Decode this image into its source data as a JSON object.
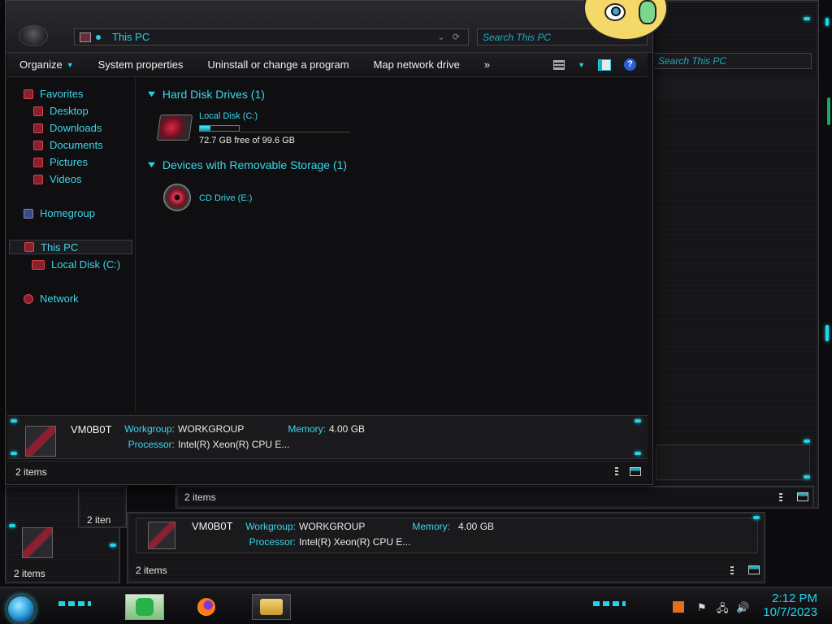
{
  "window": {
    "address": "This PC",
    "search_placeholder": "Search This PC"
  },
  "toolbar": {
    "organize": "Organize",
    "system_properties": "System properties",
    "uninstall": "Uninstall or change a program",
    "map_drive": "Map network drive",
    "more": "»"
  },
  "nav": {
    "favorites": "Favorites",
    "desktop": "Desktop",
    "downloads": "Downloads",
    "documents": "Documents",
    "pictures": "Pictures",
    "videos": "Videos",
    "homegroup": "Homegroup",
    "this_pc": "This PC",
    "local_disk": "Local Disk (C:)",
    "network": "Network"
  },
  "content": {
    "hdd_group": "Hard Disk Drives (1)",
    "removable_group": "Devices with Removable Storage (1)",
    "local_disk_name": "Local Disk (C:)",
    "local_disk_free": "72.7 GB free of 99.6 GB",
    "local_disk_used_fraction": 0.27,
    "cd_drive_name": "CD Drive (E:)"
  },
  "details": {
    "computer_name": "VM0B0T",
    "workgroup_label": "Workgroup:",
    "workgroup_value": "WORKGROUP",
    "memory_label": "Memory:",
    "memory_value": "4.00 GB",
    "processor_label": "Processor:",
    "processor_value": "Intel(R) Xeon(R) CPU E..."
  },
  "status": {
    "items": "2 items",
    "truncated_items": "2 iten"
  },
  "background_windows": {
    "search_placeholder": "Search This PC"
  },
  "taskbar": {
    "time": "2:12 PM",
    "date": "10/7/2023"
  },
  "colors": {
    "accent_cyan": "#21d4e8",
    "accent_red": "#8a1f30",
    "window_bg": "#121214"
  }
}
